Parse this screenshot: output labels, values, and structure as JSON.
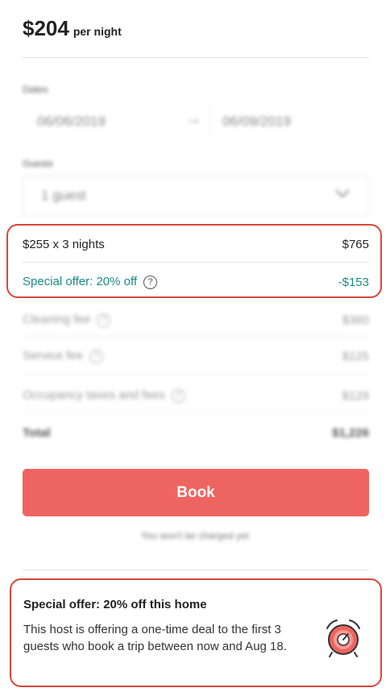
{
  "header": {
    "price": "$204",
    "price_unit": "per night"
  },
  "dates": {
    "label": "Dates",
    "check_in": "06/06/2019",
    "arrow": "→",
    "check_out": "06/09/2019"
  },
  "guests": {
    "label": "Guests",
    "value": "1 guest",
    "chevron": "⌵"
  },
  "price_breakdown": {
    "nightly": {
      "label": "$255 x 3 nights",
      "amount": "$765"
    },
    "special_offer": {
      "label": "Special offer: 20% off",
      "amount": "-$153"
    },
    "cleaning_fee": {
      "label": "Cleaning fee",
      "amount": "$360"
    },
    "service_fee": {
      "label": "Service fee",
      "amount": "$125"
    },
    "occupancy_taxes": {
      "label": "Occupancy taxes and fees",
      "amount": "$129"
    },
    "total": {
      "label": "Total",
      "amount": "$1,226"
    },
    "help_glyph": "?"
  },
  "book": {
    "label": "Book",
    "note": "You won't be charged yet"
  },
  "promo": {
    "title": "Special offer: 20% off this home",
    "text": "This host is offering a one-time deal to the first 3 guests who book a trip between now and Aug 18.",
    "icon": "alarm-clock-icon"
  },
  "colors": {
    "accent": "#ee6460",
    "offer_teal": "#1a8a86",
    "highlight_red": "#d9463a"
  }
}
